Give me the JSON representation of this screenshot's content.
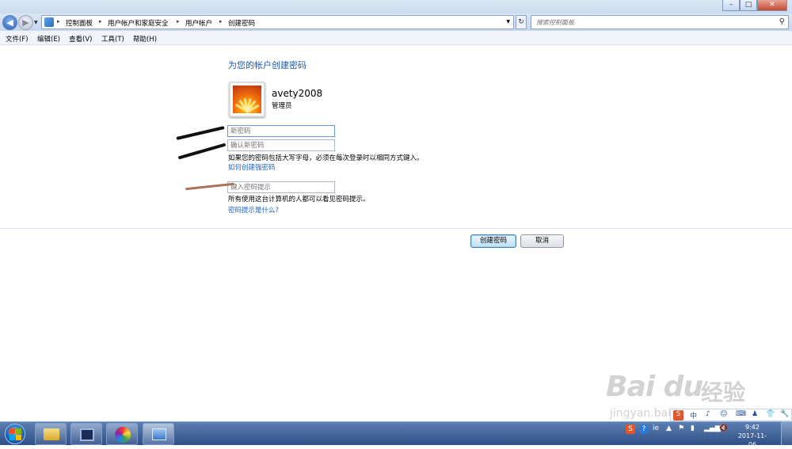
{
  "window": {
    "buttons": {
      "minimize": "–",
      "maximize": "□",
      "close": "✕"
    }
  },
  "nav": {
    "back": "◀",
    "forward": "▶",
    "breadcrumbs": [
      "控制面板",
      "用户帐户和家庭安全",
      "用户帐户",
      "创建密码"
    ],
    "separator": "▸",
    "refresh": "↻",
    "search_placeholder": "搜索控制面板",
    "search_icon": "magnifier"
  },
  "menu": [
    "文件(F)",
    "编辑(E)",
    "查看(V)",
    "工具(T)",
    "帮助(H)"
  ],
  "main": {
    "title": "为您的帐户创建密码",
    "username": "avety2008",
    "role": "管理员",
    "new_password_placeholder": "新密码",
    "confirm_password_placeholder": "确认新密码",
    "caps_hint": "如果您的密码包括大写字母，必须在每次登录时以相同方式键入。",
    "strong_link": "如何创建强密码",
    "hint_placeholder": "键入密码提示",
    "hint_visibility": "所有使用这台计算机的人都可以看见密码提示。",
    "hint_link": "密码提示是什么?",
    "create_button": "创建密码",
    "cancel_button": "取消"
  },
  "overlay": {
    "scribble_colors": [
      "#111111",
      "#111111",
      "#a8735a"
    ]
  },
  "watermark": {
    "brand": "Bai du",
    "brand_cn": "经验",
    "url": "jingyan.baidu.com"
  },
  "langbar": [
    "S",
    "中",
    "♪",
    "☺",
    "⌨",
    "♟",
    "👕",
    "🔧"
  ],
  "taskbar": {
    "apps": [
      "explorer",
      "media-center",
      "color-app",
      "control-panel"
    ],
    "tray_icons": [
      "S",
      "?",
      "ie",
      "▲",
      "flag",
      "device",
      "signal",
      "volume"
    ],
    "time": "9:42",
    "date": "2017-11-06"
  },
  "colors": {
    "accent_title": "#1e5aa8",
    "link": "#1f63c6",
    "taskbar": "#2f4f86"
  }
}
